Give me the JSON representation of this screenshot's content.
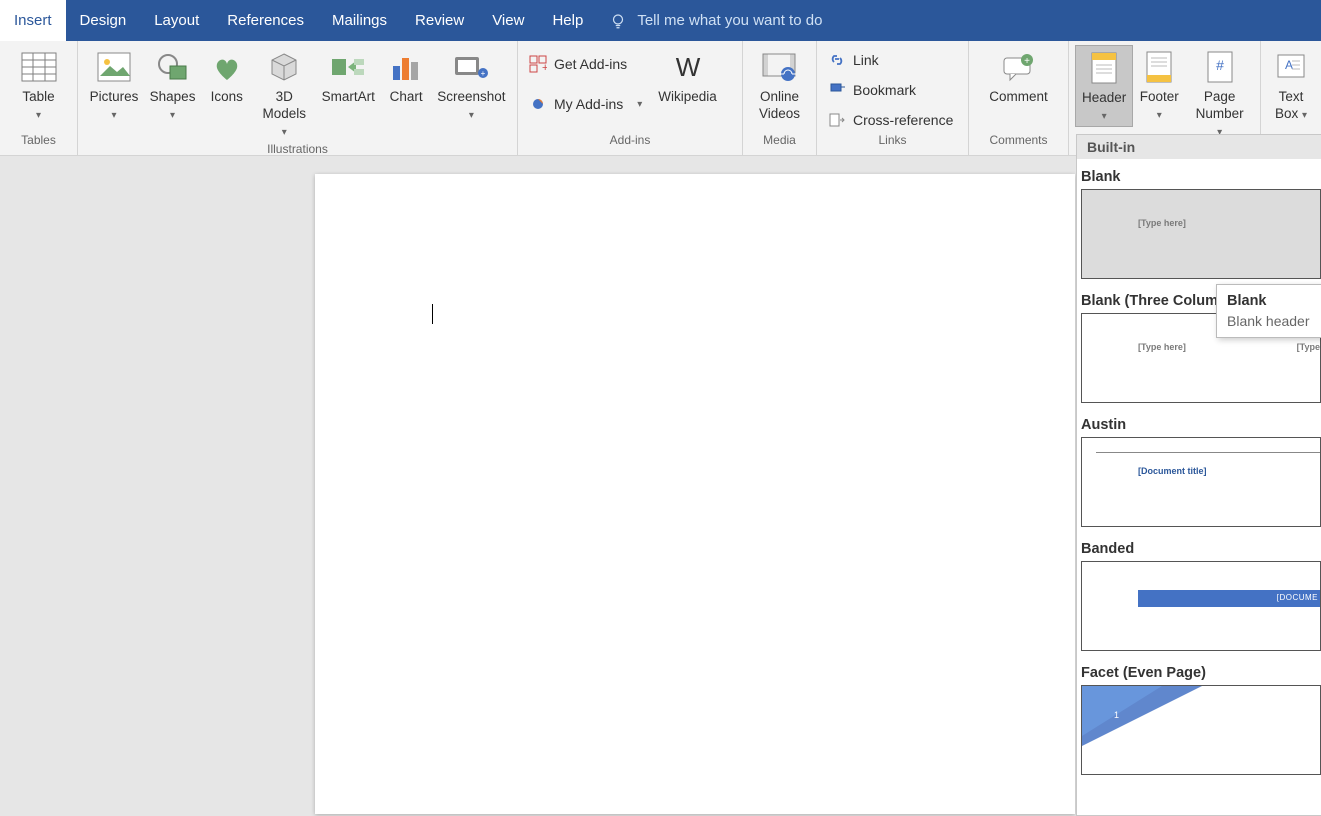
{
  "tabs": [
    "Insert",
    "Design",
    "Layout",
    "References",
    "Mailings",
    "Review",
    "View",
    "Help"
  ],
  "active_tab": 0,
  "tellme": "Tell me what you want to do",
  "groups": {
    "tables": {
      "label": "Tables",
      "table": "Table"
    },
    "illustrations": {
      "label": "Illustrations",
      "pictures": "Pictures",
      "shapes": "Shapes",
      "icons": "Icons",
      "models": "3D\nModels",
      "smartart": "SmartArt",
      "chart": "Chart",
      "screenshot": "Screenshot"
    },
    "addins": {
      "label": "Add-ins",
      "get": "Get Add-ins",
      "my": "My Add-ins",
      "wiki": "Wikipedia"
    },
    "media": {
      "label": "Media",
      "video": "Online\nVideos"
    },
    "links": {
      "label": "Links",
      "link": "Link",
      "bookmark": "Bookmark",
      "xref": "Cross-reference"
    },
    "comments": {
      "label": "Comments",
      "comment": "Comment"
    },
    "headerfooter": {
      "header": "Header",
      "footer": "Footer",
      "pagenum": "Page\nNumber"
    },
    "text": {
      "textbox": "Text\nBox"
    }
  },
  "gallery": {
    "header": "Built-in",
    "items": [
      {
        "name": "Blank",
        "placeholder": "[Type here]"
      },
      {
        "name": "Blank (Three Columns)",
        "placeholder": "[Type here]",
        "placeholder_r": "[Type"
      },
      {
        "name": "Austin",
        "placeholder": "[Document title]"
      },
      {
        "name": "Banded",
        "placeholder": "[DOCUME"
      },
      {
        "name": "Facet (Even Page)",
        "placeholder": "1"
      }
    ]
  },
  "tooltip": {
    "title": "Blank",
    "desc": "Blank header"
  }
}
